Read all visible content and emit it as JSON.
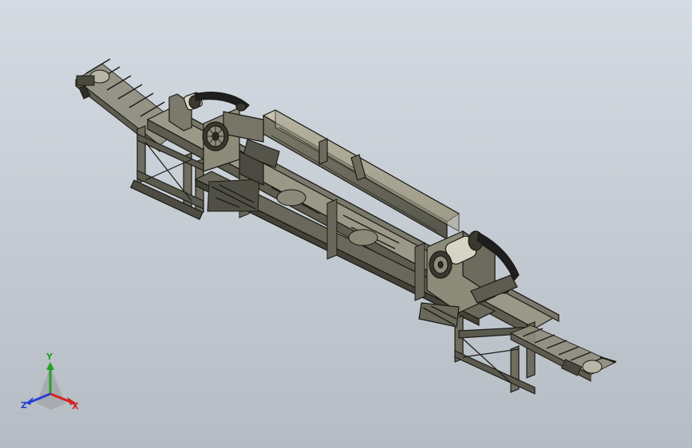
{
  "viewport": {
    "background_top": "#d5dbe2",
    "background_bottom": "#b5bcc4"
  },
  "model": {
    "frame_color": "#6f6d60",
    "frame_light": "#9a9886",
    "frame_dark": "#3a392f",
    "edge_color": "#1a1a14",
    "belt_color": "#1e1e1e"
  },
  "triad": {
    "x_label": "X",
    "y_label": "Y",
    "z_label": "Z",
    "x_color": "#d42323",
    "y_color": "#28a028",
    "z_color": "#2840d4"
  }
}
